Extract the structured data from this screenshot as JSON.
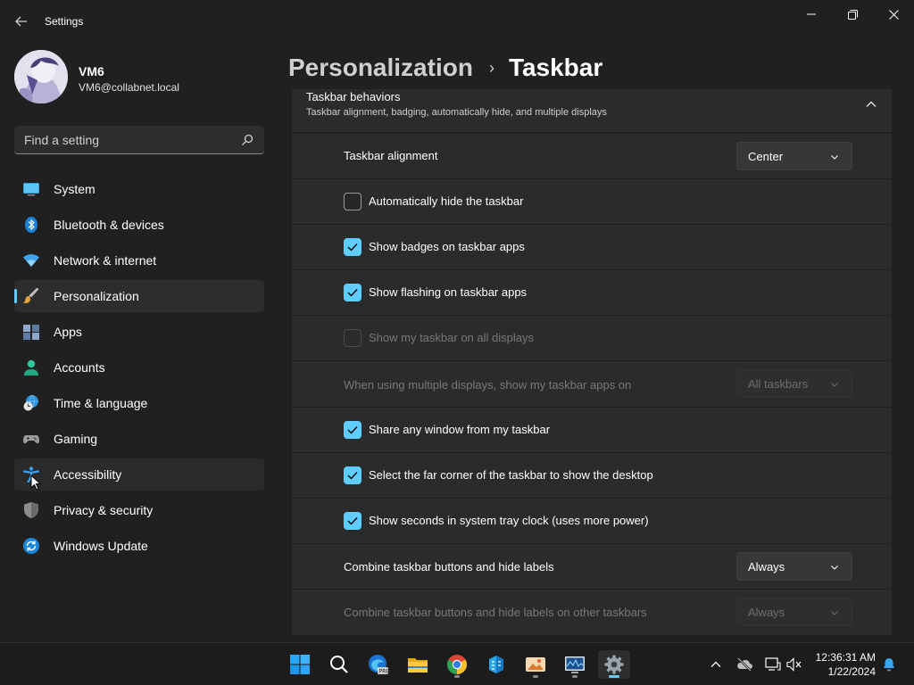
{
  "window": {
    "title": "Settings",
    "icons": {
      "back": "back-arrow-icon",
      "minimize": "minimize-icon",
      "restore": "restore-icon",
      "close": "close-icon"
    }
  },
  "user": {
    "name": "VM6",
    "email": "VM6@collabnet.local"
  },
  "search": {
    "placeholder": "Find a setting",
    "icon": "search-icon"
  },
  "sidebar": {
    "items": [
      {
        "label": "System",
        "icon": "system-display-icon"
      },
      {
        "label": "Bluetooth & devices",
        "icon": "bluetooth-icon"
      },
      {
        "label": "Network & internet",
        "icon": "wifi-icon"
      },
      {
        "label": "Personalization",
        "icon": "brush-icon",
        "selected": true
      },
      {
        "label": "Apps",
        "icon": "apps-icon"
      },
      {
        "label": "Accounts",
        "icon": "person-icon"
      },
      {
        "label": "Time & language",
        "icon": "globe-clock-icon"
      },
      {
        "label": "Gaming",
        "icon": "gamepad-icon"
      },
      {
        "label": "Accessibility",
        "icon": "accessibility-icon",
        "hover": true
      },
      {
        "label": "Privacy & security",
        "icon": "shield-icon"
      },
      {
        "label": "Windows Update",
        "icon": "update-icon"
      }
    ]
  },
  "header": {
    "parent": "Personalization",
    "separator": "›",
    "current": "Taskbar"
  },
  "group": {
    "title": "Taskbar behaviors",
    "subtitle": "Taskbar alignment, badging, automatically hide, and multiple displays"
  },
  "settings": {
    "alignment": {
      "label": "Taskbar alignment",
      "value": "Center"
    },
    "auto_hide": {
      "label": "Automatically hide the taskbar",
      "checked": false
    },
    "badges": {
      "label": "Show badges on taskbar apps",
      "checked": true
    },
    "flashing": {
      "label": "Show flashing on taskbar apps",
      "checked": true
    },
    "all_displays": {
      "label": "Show my taskbar on all displays",
      "checked": false,
      "disabled": true
    },
    "multi_display": {
      "label": "When using multiple displays, show my taskbar apps on",
      "value": "All taskbars",
      "disabled": true
    },
    "share_window": {
      "label": "Share any window from my taskbar",
      "checked": true
    },
    "far_corner": {
      "label": "Select the far corner of the taskbar to show the desktop",
      "checked": true
    },
    "seconds": {
      "label": "Show seconds in system tray clock (uses more power)",
      "checked": true
    },
    "combine": {
      "label": "Combine taskbar buttons and hide labels",
      "value": "Always"
    },
    "combine_other": {
      "label": "Combine taskbar buttons and hide labels on other taskbars",
      "value": "Always",
      "disabled": true
    }
  },
  "taskbar": {
    "apps": [
      "start-icon",
      "search-icon",
      "edge-beta-icon",
      "file-explorer-icon",
      "chrome-icon",
      "azure-data-icon",
      "photos-icon",
      "performance-monitor-icon",
      "settings-gear-icon"
    ],
    "tray": [
      "chevron-up-icon",
      "onedrive-off-icon",
      "network-monitor-icon",
      "volume-muted-icon",
      "notification-bell-icon"
    ],
    "time": "12:36:31 AM",
    "date": "1/22/2024"
  },
  "colors": {
    "accent": "#60cdff",
    "background": "#202020",
    "card": "#2b2b2b"
  }
}
